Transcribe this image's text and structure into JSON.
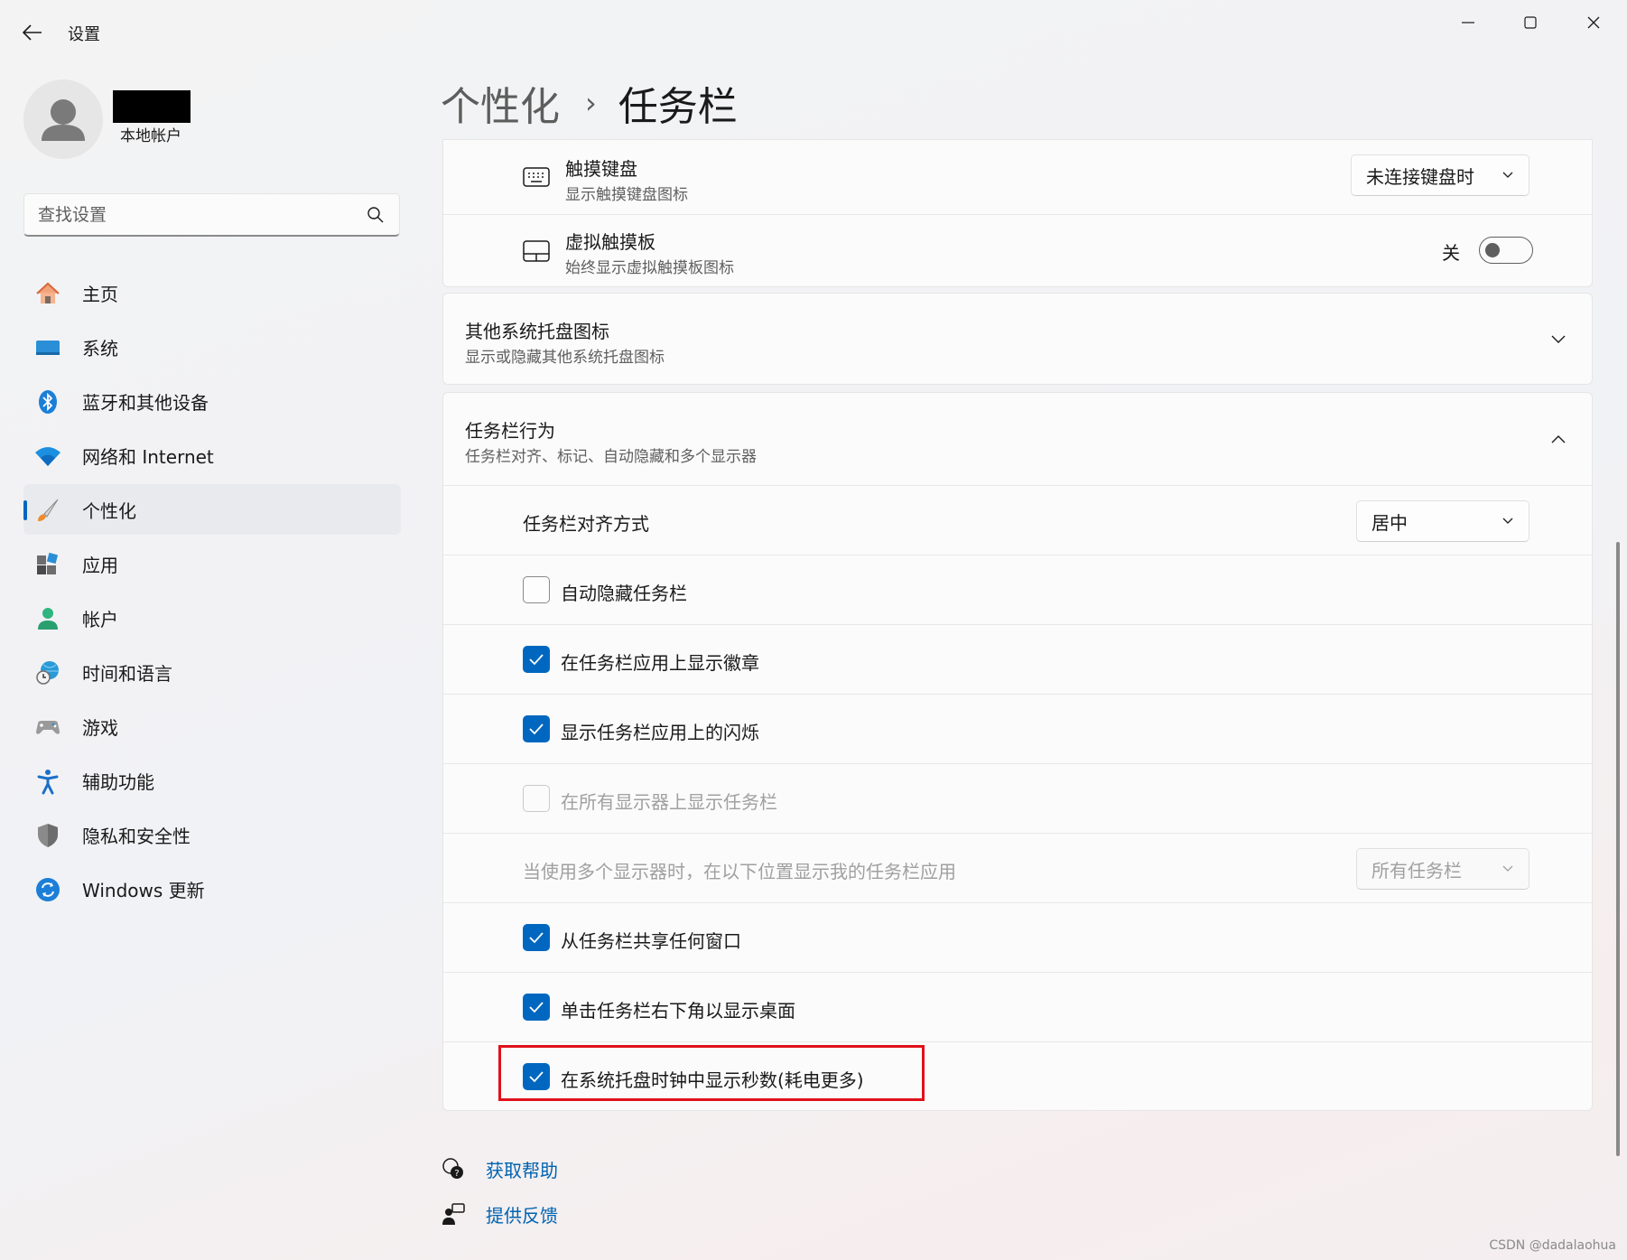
{
  "app": {
    "title": "设置"
  },
  "user": {
    "account_type": "本地帐户"
  },
  "search": {
    "placeholder": "查找设置"
  },
  "sidebar": {
    "items": [
      {
        "label": "主页",
        "icon": "home-icon"
      },
      {
        "label": "系统",
        "icon": "system-icon"
      },
      {
        "label": "蓝牙和其他设备",
        "icon": "bluetooth-icon"
      },
      {
        "label": "网络和 Internet",
        "icon": "wifi-icon"
      },
      {
        "label": "个性化",
        "icon": "brush-icon",
        "active": true
      },
      {
        "label": "应用",
        "icon": "apps-icon"
      },
      {
        "label": "帐户",
        "icon": "account-icon"
      },
      {
        "label": "时间和语言",
        "icon": "globe-clock-icon"
      },
      {
        "label": "游戏",
        "icon": "gamepad-icon"
      },
      {
        "label": "辅助功能",
        "icon": "accessibility-icon"
      },
      {
        "label": "隐私和安全性",
        "icon": "shield-icon"
      },
      {
        "label": "Windows 更新",
        "icon": "update-icon"
      }
    ]
  },
  "breadcrumb": {
    "parent": "个性化",
    "separator": "›",
    "current": "任务栏"
  },
  "settings": {
    "touch_keyboard": {
      "title": "触摸键盘",
      "subtitle": "显示触摸键盘图标",
      "value": "未连接键盘时"
    },
    "virtual_touchpad": {
      "title": "虚拟触摸板",
      "subtitle": "始终显示虚拟触摸板图标",
      "state_label": "关",
      "on": false
    },
    "other_tray": {
      "title": "其他系统托盘图标",
      "subtitle": "显示或隐藏其他系统托盘图标"
    },
    "behavior": {
      "title": "任务栏行为",
      "subtitle": "任务栏对齐、标记、自动隐藏和多个显示器",
      "alignment": {
        "label": "任务栏对齐方式",
        "value": "居中"
      },
      "auto_hide": {
        "label": "自动隐藏任务栏",
        "checked": false
      },
      "badges": {
        "label": "在任务栏应用上显示徽章",
        "checked": true
      },
      "flashing": {
        "label": "显示任务栏应用上的闪烁",
        "checked": true
      },
      "all_displays": {
        "label": "在所有显示器上显示任务栏",
        "checked": false,
        "disabled": true
      },
      "multi_display": {
        "label": "当使用多个显示器时，在以下位置显示我的任务栏应用",
        "value": "所有任务栏",
        "disabled": true
      },
      "share_window": {
        "label": "从任务栏共享任何窗口",
        "checked": true
      },
      "desktop_corner": {
        "label": "单击任务栏右下角以显示桌面",
        "checked": true
      },
      "show_seconds": {
        "label": "在系统托盘时钟中显示秒数(耗电更多)",
        "checked": true
      }
    }
  },
  "footer": {
    "help": "获取帮助",
    "feedback": "提供反馈"
  },
  "watermark": "CSDN @dadalaohua",
  "colors": {
    "accent": "#0067c0",
    "highlight": "#e0111b",
    "link": "#0063b1"
  }
}
